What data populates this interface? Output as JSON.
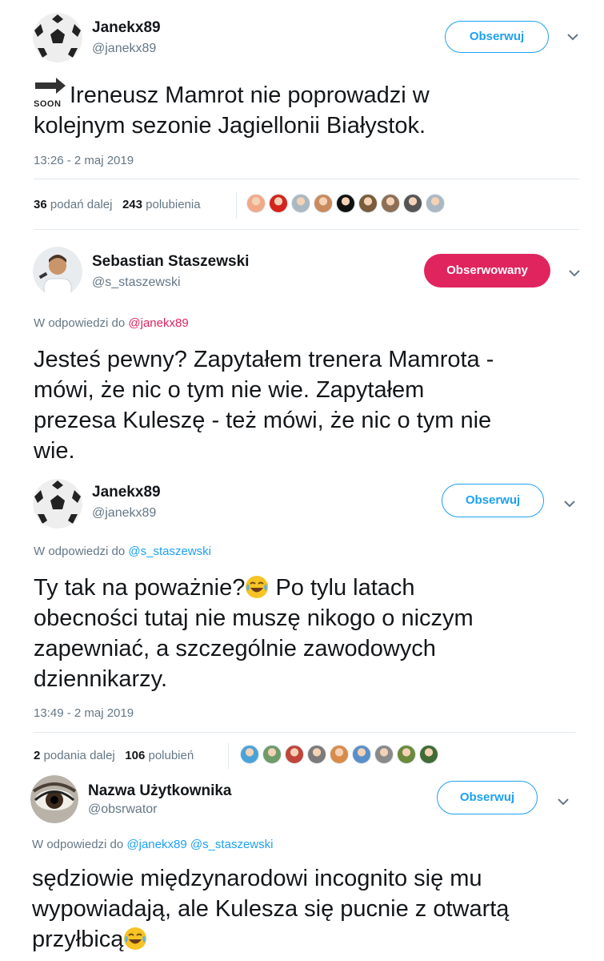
{
  "tweet1": {
    "name": "Janekx89",
    "handle": "@janekx89",
    "follow_label": "Obserwuj",
    "soon_badge": "SOON",
    "text_line1": "Ireneusz Mamrot nie poprowadzi w",
    "text_line2": "kolejnym sezonie Jagiellonii Białystok.",
    "timestamp": "13:26 - 2 maj 2019",
    "retweets_count": "36",
    "retweets_label": "podań dalej",
    "likes_count": "243",
    "likes_label": "polubienia",
    "liker_colors": [
      "#f2a98a",
      "#d4241c",
      "#aab8c2",
      "#c98a5e",
      "#111111",
      "#7a5b3a",
      "#8c6f55",
      "#555555",
      "#aab8c2"
    ]
  },
  "tweet2": {
    "name": "Sebastian Staszewski",
    "handle": "@s_staszewski",
    "follow_label": "Obserwowany",
    "reply_prefix": "W odpowiedzi do",
    "reply_mention": "@janekx89",
    "text_line1": "Jesteś pewny? Zapytałem trenera Mamrota -",
    "text_line2": "mówi, że nic o tym nie wie. Zapytałem",
    "text_line3": "prezesa Kuleszę - też mówi, że nic o tym nie",
    "text_line4": "wie."
  },
  "tweet3": {
    "name": "Janekx89",
    "handle": "@janekx89",
    "follow_label": "Obserwuj",
    "reply_prefix": "W odpowiedzi do",
    "reply_mention": "@s_staszewski",
    "text_line1_a": "Ty tak na poważnie?",
    "text_line1_b": " Po tylu latach",
    "text_line2": "obecności tutaj nie muszę nikogo o niczym",
    "text_line3": "zapewniać, a szczególnie zawodowych",
    "text_line4": "dziennikarzy.",
    "timestamp": "13:49 - 2 maj 2019",
    "retweets_count": "2",
    "retweets_label": "podania dalej",
    "likes_count": "106",
    "likes_label": "polubień",
    "liker_colors": [
      "#4aa3d8",
      "#6f9b6a",
      "#c0463a",
      "#7b7b7b",
      "#d98b4a",
      "#5b8fc9",
      "#8a8a8a",
      "#6a8a3c",
      "#3f6b34"
    ]
  },
  "tweet4": {
    "name": "Nazwa Użytkownika",
    "handle": "@obsrwator",
    "follow_label": "Obserwuj",
    "reply_prefix": "W odpowiedzi do",
    "reply_mention1": "@janekx89",
    "reply_mention2": "@s_staszewski",
    "text_line1": "sędziowie międzynarodowi incognito się mu",
    "text_line2": "wypowiadają, ale Kulesza się pucnie z otwartą",
    "text_line3": "przyłbicą"
  }
}
